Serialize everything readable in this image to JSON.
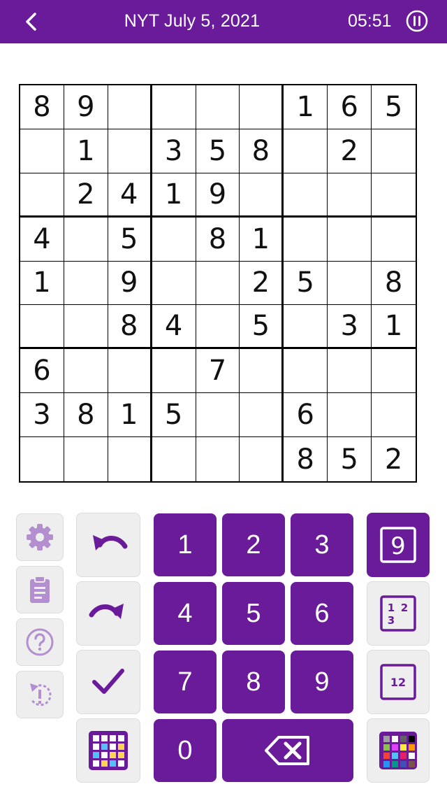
{
  "header": {
    "title": "NYT July 5, 2021",
    "timer": "05:51",
    "bg_color": "#6a1b9a"
  },
  "board": {
    "rows": [
      [
        "8",
        "9",
        "",
        "",
        "",
        "",
        "1",
        "6",
        "5"
      ],
      [
        "",
        "1",
        "",
        "3",
        "5",
        "8",
        "",
        "2",
        ""
      ],
      [
        "",
        "2",
        "4",
        "1",
        "9",
        "",
        "",
        "",
        ""
      ],
      [
        "4",
        "",
        "5",
        "",
        "8",
        "1",
        "",
        "",
        ""
      ],
      [
        "1",
        "",
        "9",
        "",
        "",
        "2",
        "5",
        "",
        "8"
      ],
      [
        "",
        "",
        "8",
        "4",
        "",
        "5",
        "",
        "3",
        "1"
      ],
      [
        "6",
        "",
        "",
        "",
        "7",
        "",
        "",
        "",
        ""
      ],
      [
        "3",
        "8",
        "1",
        "5",
        "",
        "",
        "6",
        "",
        ""
      ],
      [
        "",
        "",
        "",
        "",
        "",
        "",
        "8",
        "5",
        "2"
      ]
    ]
  },
  "keypad": {
    "digits": [
      "1",
      "2",
      "3",
      "4",
      "5",
      "6",
      "7",
      "8",
      "9",
      "0"
    ]
  },
  "side_buttons": [
    "gear-icon",
    "clipboard-icon",
    "help-icon",
    "restart-icon"
  ],
  "tool_buttons": [
    "undo-icon",
    "redo-icon",
    "check-icon",
    "color-grid-icon"
  ],
  "modes": {
    "normal_label": "9",
    "candidate_labels": [
      "1",
      "2",
      "3"
    ],
    "center_label": "12",
    "active": "normal"
  },
  "colors": {
    "accent": "#6a1b9a",
    "icon_light": "#b38fd0",
    "button_bg": "#eeeeee"
  }
}
